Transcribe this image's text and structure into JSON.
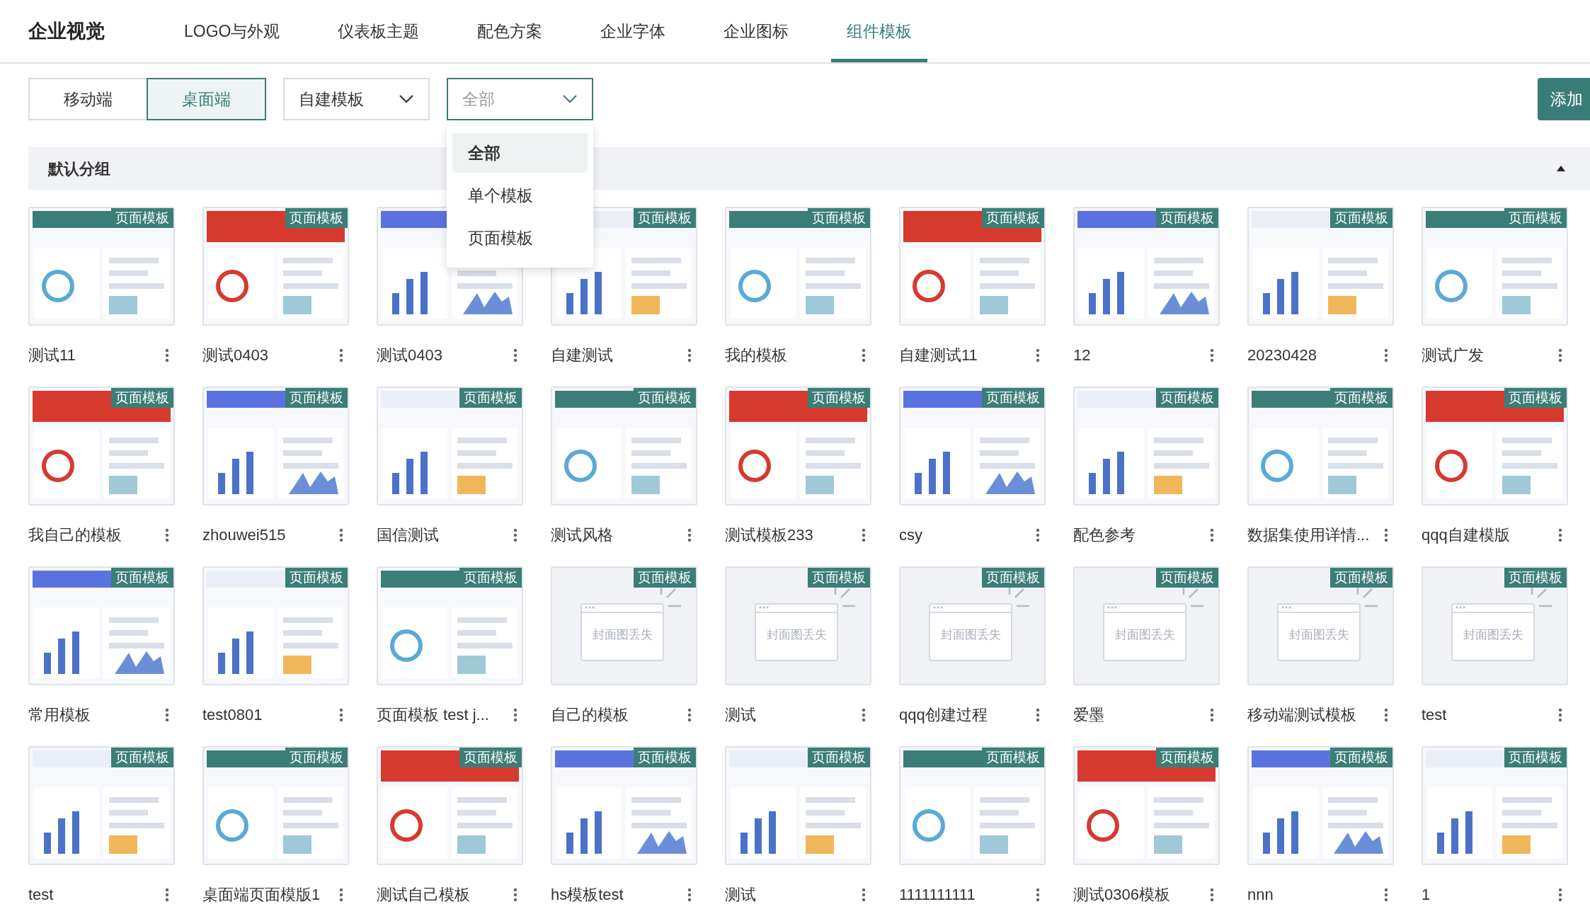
{
  "nav": {
    "title": "企业视觉",
    "tabs": [
      {
        "label": "LOGO与外观",
        "selected": false
      },
      {
        "label": "仪表板主题",
        "selected": false
      },
      {
        "label": "配色方案",
        "selected": false
      },
      {
        "label": "企业字体",
        "selected": false
      },
      {
        "label": "企业图标",
        "selected": false
      },
      {
        "label": "组件模板",
        "selected": true
      }
    ]
  },
  "platform": [
    {
      "label": "移动端",
      "selected": false
    },
    {
      "label": "桌面端",
      "selected": true
    }
  ],
  "source_select": {
    "value": "自建模板",
    "expanded": false
  },
  "type_select": {
    "value": "全部",
    "expanded": true,
    "options": [
      {
        "label": "全部",
        "selected": true
      },
      {
        "label": "单个模板",
        "selected": false
      },
      {
        "label": "页面模板",
        "selected": false
      }
    ]
  },
  "add_button": "添加",
  "group": {
    "title": "默认分组",
    "expanded": true,
    "cards": [
      {
        "name": "测试11",
        "badge": "页面模板",
        "kind": "picture"
      },
      {
        "name": "测试0403",
        "badge": "页面模板",
        "kind": "picture"
      },
      {
        "name": "测试0403",
        "kind": "picture"
      },
      {
        "name": "自建测试",
        "badge": "页面模板",
        "kind": "picture"
      },
      {
        "name": "我的模板",
        "badge": "页面模板",
        "kind": "picture"
      },
      {
        "name": "自建测试11",
        "badge": "页面模板",
        "kind": "picture"
      },
      {
        "name": "12",
        "badge": "页面模板",
        "kind": "picture"
      },
      {
        "name": "20230428",
        "badge": "页面模板",
        "kind": "picture"
      },
      {
        "name": "测试广发",
        "badge": "页面模板",
        "kind": "picture"
      },
      {
        "name": "我自己的模板",
        "badge": "页面模板",
        "kind": "picture"
      },
      {
        "name": "zhouwei515",
        "badge": "页面模板",
        "kind": "picture"
      },
      {
        "name": "国信测试",
        "badge": "页面模板",
        "kind": "picture"
      },
      {
        "name": "测试风格",
        "badge": "页面模板",
        "kind": "picture"
      },
      {
        "name": "测试模板233",
        "badge": "页面模板",
        "kind": "picture"
      },
      {
        "name": "csy",
        "badge": "页面模板",
        "kind": "picture"
      },
      {
        "name": "配色参考",
        "badge": "页面模板",
        "kind": "picture"
      },
      {
        "name": "数据集使用详情...",
        "badge": "页面模板",
        "kind": "picture"
      },
      {
        "name": "qqq自建模版",
        "badge": "页面模板",
        "kind": "picture"
      },
      {
        "name": "常用模板",
        "badge": "页面模板",
        "kind": "picture"
      },
      {
        "name": "test0801",
        "badge": "页面模板",
        "kind": "picture"
      },
      {
        "name": "页面模板 test j...",
        "badge": "页面模板",
        "kind": "picture"
      },
      {
        "name": "自己的模板",
        "badge": "页面模板",
        "kind": "missing",
        "cover_text": "封面图丢失"
      },
      {
        "name": "测试",
        "badge": "页面模板",
        "kind": "missing",
        "cover_text": "封面图丢失"
      },
      {
        "name": "qqq创建过程",
        "badge": "页面模板",
        "kind": "missing",
        "cover_text": "封面图丢失"
      },
      {
        "name": "爱墨",
        "badge": "页面模板",
        "kind": "missing",
        "cover_text": "封面图丢失"
      },
      {
        "name": "移动端测试模板",
        "badge": "页面模板",
        "kind": "missing",
        "cover_text": "封面图丢失"
      },
      {
        "name": "test",
        "badge": "页面模板",
        "kind": "missing",
        "cover_text": "封面图丢失"
      },
      {
        "name": "test",
        "badge": "页面模板",
        "kind": "picture"
      },
      {
        "name": "桌面端页面模版1",
        "badge": "页面模板",
        "kind": "picture"
      },
      {
        "name": "测试自己模板",
        "badge": "页面模板",
        "kind": "picture"
      },
      {
        "name": "hs模板test",
        "badge": "页面模板",
        "kind": "picture"
      },
      {
        "name": "测试",
        "badge": "页面模板",
        "kind": "picture"
      },
      {
        "name": "1111111111",
        "badge": "页面模板",
        "kind": "picture"
      },
      {
        "name": "测试0306模板",
        "badge": "页面模板",
        "kind": "picture"
      },
      {
        "name": "nnn",
        "badge": "页面模板",
        "kind": "picture"
      },
      {
        "name": "1",
        "badge": "页面模板",
        "kind": "picture"
      }
    ]
  }
}
